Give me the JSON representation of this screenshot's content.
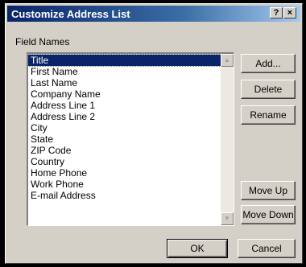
{
  "dialog": {
    "title": "Customize Address List",
    "help_button": "?",
    "close_button": "×"
  },
  "field_names": {
    "label": "Field Names",
    "items": [
      {
        "label": "Title",
        "selected": true
      },
      {
        "label": "First Name"
      },
      {
        "label": "Last Name"
      },
      {
        "label": "Company Name"
      },
      {
        "label": "Address Line 1"
      },
      {
        "label": "Address Line 2"
      },
      {
        "label": "City"
      },
      {
        "label": "State"
      },
      {
        "label": "ZIP Code"
      },
      {
        "label": "Country"
      },
      {
        "label": "Home Phone"
      },
      {
        "label": "Work Phone"
      },
      {
        "label": "E-mail Address"
      }
    ]
  },
  "buttons": {
    "add": "Add...",
    "delete": "Delete",
    "rename": "Rename",
    "move_up": "Move Up",
    "move_down": "Move Down",
    "ok": "OK",
    "cancel": "Cancel"
  },
  "icons": {
    "scroll_up": "scroll-up-arrow-icon",
    "scroll_down": "scroll-down-arrow-icon"
  },
  "colors": {
    "title_bar_start": "#0a246a",
    "title_bar_end": "#a6caf0",
    "selection": "#0a246a",
    "dialog_face": "#d4d0c8"
  }
}
